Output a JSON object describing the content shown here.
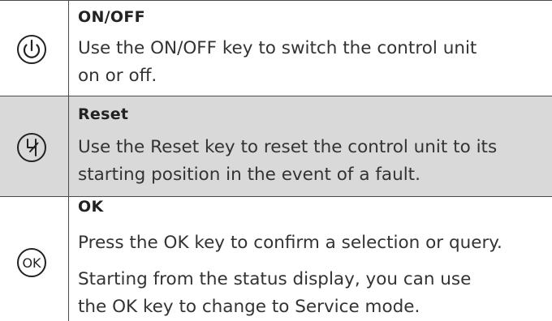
{
  "rows": [
    {
      "icon": "power-icon",
      "title": "ON/OFF",
      "lines": [
        "Use the ON/OFF key to switch the control unit",
        "on or off."
      ]
    },
    {
      "icon": "reset-icon",
      "title": "Reset",
      "lines": [
        "Use the Reset key to reset the control unit to its",
        "starting position in the event of a fault."
      ]
    },
    {
      "icon": "ok-icon",
      "icon_text": "OK",
      "title": "OK",
      "para1": "Press the OK key to confirm a selection or query.",
      "para2_lines": [
        "Starting from the status display, you can use",
        "the OK key to change to Service mode."
      ]
    }
  ]
}
